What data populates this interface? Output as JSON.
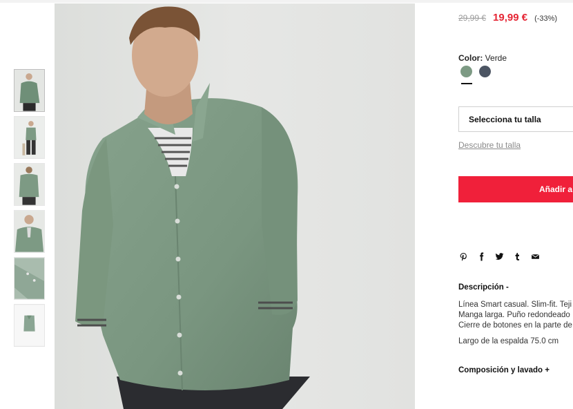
{
  "price": {
    "old": "29,99 €",
    "current": "19,99 €",
    "discount": "(-33%)"
  },
  "color": {
    "label": "Color:",
    "value": "Verde",
    "swatches": [
      {
        "name": "Verde",
        "hex": "#7d9a84",
        "selected": true
      },
      {
        "name": "Azul marino",
        "hex": "#4c5563",
        "selected": false
      }
    ]
  },
  "size": {
    "select_label": "Selecciona tu talla",
    "guide_link": "Descubre tu talla"
  },
  "cart": {
    "add_label": "Añadir a"
  },
  "share_icons": [
    "pinterest-icon",
    "facebook-icon",
    "twitter-icon",
    "tumblr-icon",
    "email-icon"
  ],
  "description": {
    "title": "Descripción -",
    "lines": [
      "Línea Smart casual. Slim-fit. Teji",
      "Manga larga. Puño redondeado",
      "Cierre de botones en la parte de"
    ],
    "length": "Largo de la espalda 75.0 cm"
  },
  "composition": {
    "title": "Composición y lavado +"
  },
  "colors": {
    "accent": "#f0203a",
    "price_red": "#e52534",
    "shirt_green": "#7d9a84"
  }
}
